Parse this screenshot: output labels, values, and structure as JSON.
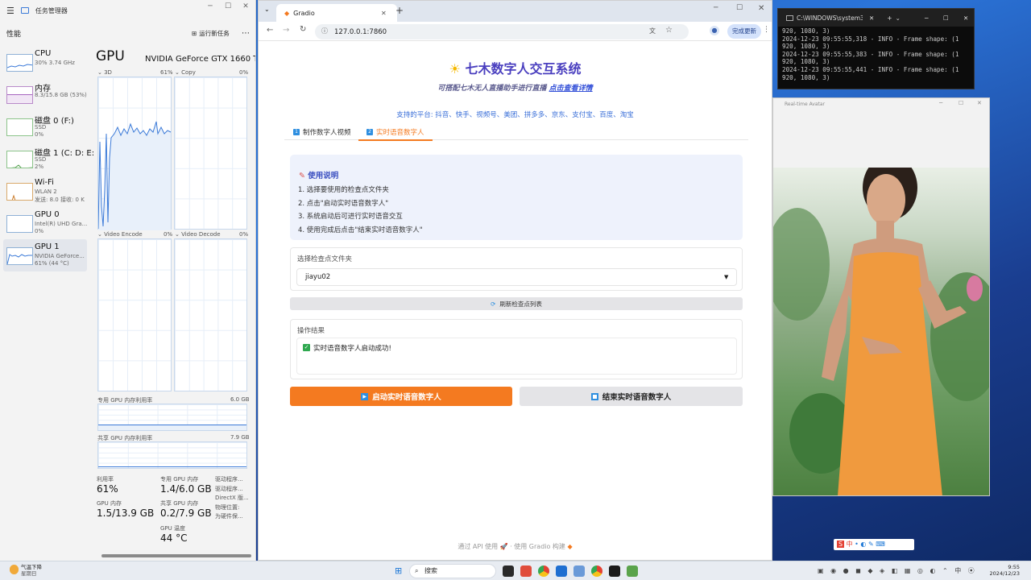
{
  "task_manager": {
    "title": "任务管理器",
    "section": "性能",
    "run_task": "运行新任务",
    "items": [
      {
        "name": "CPU",
        "line1": "30% 3.74 GHz",
        "line2": ""
      },
      {
        "name": "内存",
        "line1": "8.3/15.8 GB (53%)",
        "line2": ""
      },
      {
        "name": "磁盘 0 (F:)",
        "line1": "SSD",
        "line2": "0%"
      },
      {
        "name": "磁盘 1 (C: D: E:",
        "line1": "SSD",
        "line2": "2%"
      },
      {
        "name": "Wi-Fi",
        "line1": "WLAN 2",
        "line2": "发送: 8.0 接收: 0 K"
      },
      {
        "name": "GPU 0",
        "line1": "Intel(R) UHD Gra...",
        "line2": "0%"
      },
      {
        "name": "GPU 1",
        "line1": "NVIDIA GeForce...",
        "line2": "61% (44 °C)"
      }
    ],
    "gpu_heading": "GPU",
    "gpu_model": "NVIDIA GeForce GTX 1660 Ti",
    "graphs": {
      "g3d": "3D",
      "g3d_pct": "61%",
      "copy": "Copy",
      "copy_pct": "0%",
      "venc": "Video Encode",
      "venc_pct": "0%",
      "vdec": "Video Decode",
      "vdec_pct": "0%",
      "dedicated": "专用 GPU 内存利用率",
      "dedicated_max": "6.0 GB",
      "shared": "共享 GPU 内存利用率",
      "shared_max": "7.9 GB"
    },
    "stats": {
      "util_k": "利用率",
      "util_v": "61%",
      "gpumem_k": "GPU 内存",
      "gpumem_v": "1.5/13.9 GB",
      "ded_k": "专用 GPU 内存",
      "ded_v": "1.4/6.0 GB",
      "shr_k": "共享 GPU 内存",
      "shr_v": "0.2/7.9 GB",
      "temp_k": "GPU 温度",
      "temp_v": "44 °C",
      "driver1": "驱动程序...",
      "driver2": "驱动程序...",
      "directx": "DirectX 版...",
      "location": "物理位置:",
      "reserved": "为硬件保..."
    }
  },
  "browser": {
    "tab_title": "Gradio",
    "url": "127.0.0.1:7860",
    "update_btn": "完成更新",
    "app_title": "七木数字人交互系统",
    "subtitle": "可搭配七木无人直播助手进行直播",
    "subtitle_link": "点击查看详情",
    "platforms": "支持的平台: 抖音、快手、视频号、美团、拼多多、京东、支付宝、百度、淘宝",
    "tab1_num": "1",
    "tab1": "制作数字人视频",
    "tab2_num": "2",
    "tab2": "实时语音数字人",
    "instructions_title": "使用说明",
    "steps": [
      "1. 选择要使用的检查点文件夹",
      "2. 点击\"启动实时语音数字人\"",
      "3. 系统启动后可进行实时语音交互",
      "4. 使用完成后点击\"结束实时语音数字人\""
    ],
    "checkpoint_label": "选择检查点文件夹",
    "checkpoint_value": "jiayu02",
    "refresh_btn": "刷新检查点列表",
    "result_label": "操作结果",
    "result_text": "实时语音数字人启动成功!",
    "start_btn": "启动实时语音数字人",
    "stop_btn": "结束实时语音数字人",
    "footer_api": "通过 API 使用",
    "footer_built": "使用 Gradio 构建"
  },
  "terminal": {
    "title": "C:\\WINDOWS\\system32",
    "lines": [
      "920, 1080, 3)",
      "2024-12-23 09:55:55,318 - INFO - Frame shape: (1",
      "920, 1080, 3)",
      "2024-12-23 09:55:55,383 - INFO - Frame shape: (1",
      "920, 1080, 3)",
      "2024-12-23 09:55:55,441 - INFO - Frame shape: (1",
      "920, 1080, 3)"
    ]
  },
  "avatar_window": {
    "title": "Real-time Avatar"
  },
  "taskbar": {
    "weather": "气温下降",
    "weather_sub": "星期日",
    "search": "搜索",
    "ime": "中",
    "time": "9:55",
    "date": "2024/12/23"
  },
  "colors": {
    "accent_orange": "#f47a20",
    "title_purple": "#4a3fbf",
    "info_bg": "#eef2fc"
  }
}
